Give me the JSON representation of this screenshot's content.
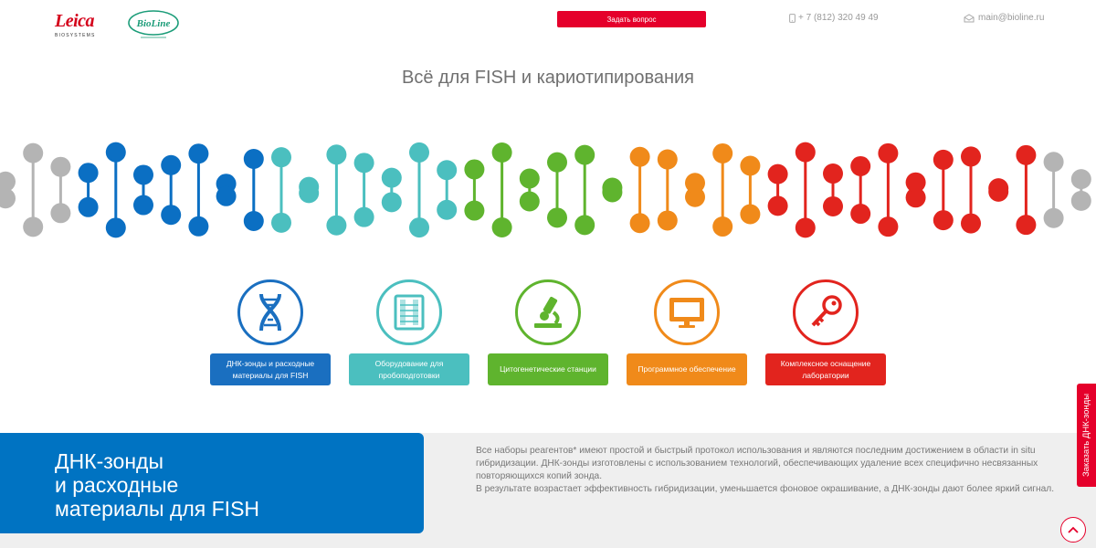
{
  "header": {
    "leica_wordmark": "Leica",
    "leica_sub": "BIOSYSTEMS",
    "bioline_wordmark": "BioLine",
    "ask_label": "Задать вопрос",
    "phone": "+ 7 (812) 320 49 49",
    "email": "main@bioline.ru"
  },
  "title": "Всё для FISH и кариотипирования",
  "colors": {
    "grey": "#b4b4b4",
    "blue": "#0b6fc3",
    "teal": "#4bbfbf",
    "green": "#5fb42e",
    "orange": "#f08a1a",
    "red": "#e2241e",
    "accent": "#e5002b"
  },
  "categories": [
    {
      "label": "ДНК-зонды и расходные материалы для FISH",
      "icon": "dna-icon",
      "color": "#1a6fc0"
    },
    {
      "label": "Оборудование для пробоподготовки",
      "icon": "slide-rack-icon",
      "color": "#4bbfbf"
    },
    {
      "label": "Цитогенетические станции",
      "icon": "microscope-icon",
      "color": "#5fb42e"
    },
    {
      "label": "Программное обеспечение",
      "icon": "monitor-icon",
      "color": "#f08a1a"
    },
    {
      "label": "Комплексное оснащение лаборатории",
      "icon": "key-icon",
      "color": "#e2241e"
    }
  ],
  "section": {
    "heading": "ДНК-зонды\nи расходные\nматериалы для FISH",
    "paragraph1": "Все наборы реагентов* имеют простой и быстрый протокол использования и являются последним достижением в области in situ гибридизации. ДНК-зонды изготовлены с использованием технологий, обеспечивающих удаление всех специфично несвязанных повторяющихся копий зонда.",
    "paragraph2": "В результате возрастает эффективность гибридизации, уменьшается фоновое окрашивание, а ДНК-зонды дают более яркий сигнал."
  },
  "side_tab_label": "Заказать ДНК-зонды"
}
